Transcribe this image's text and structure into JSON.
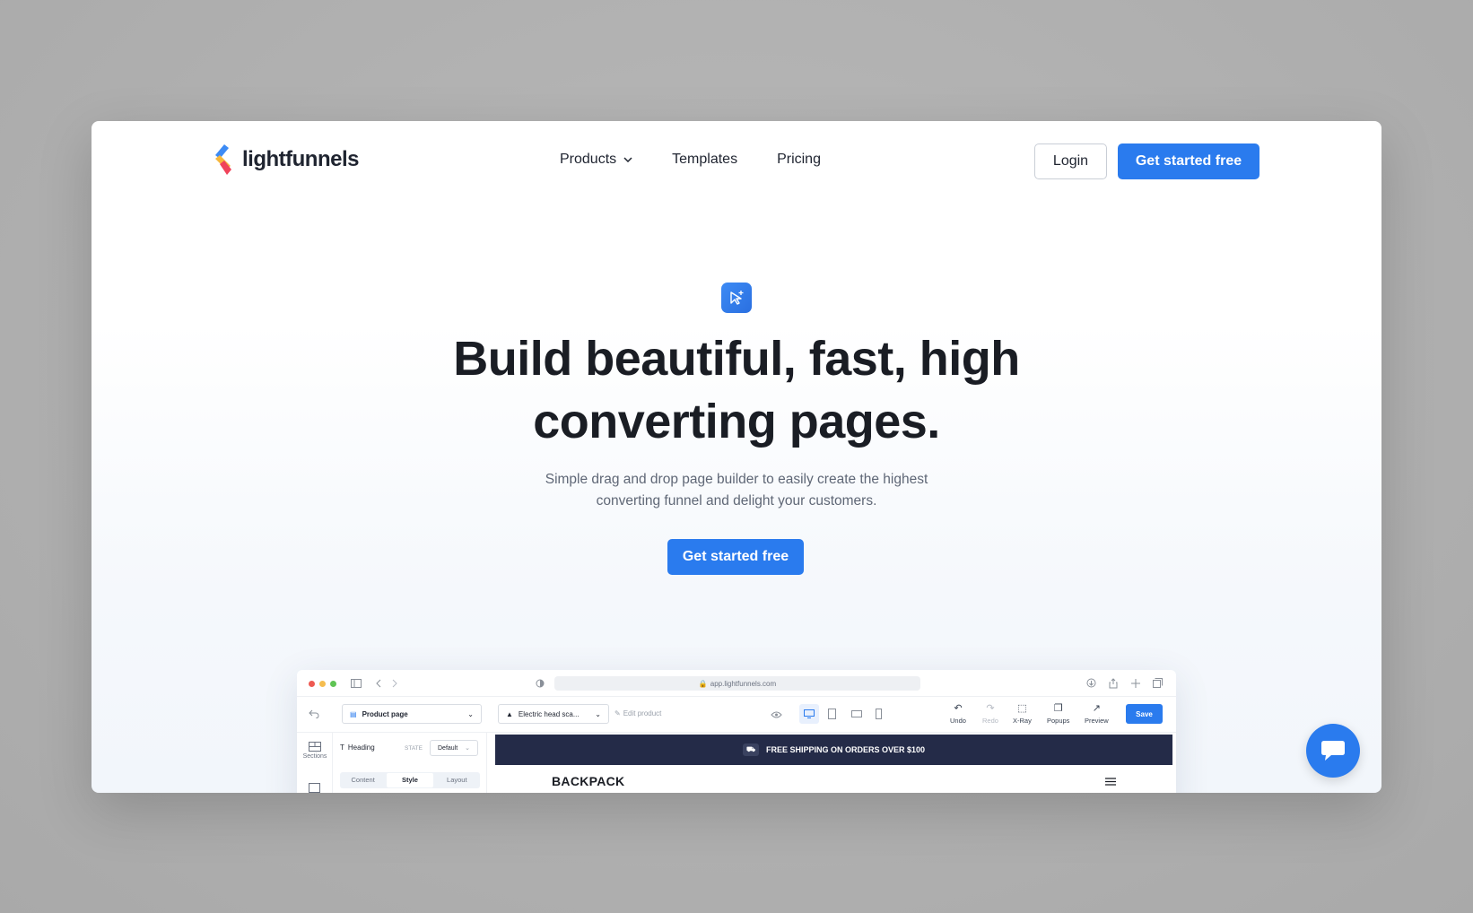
{
  "brand": {
    "name": "lightfunnels"
  },
  "nav": {
    "items": [
      {
        "label": "Products"
      },
      {
        "label": "Templates"
      },
      {
        "label": "Pricing"
      }
    ],
    "login_label": "Login",
    "cta_label": "Get started free"
  },
  "hero": {
    "title_line1": "Build beautiful, fast, high",
    "title_line2": "converting pages.",
    "subtitle_line1": "Simple drag and drop page builder to easily create the highest",
    "subtitle_line2": "converting funnel and delight your customers.",
    "cta_label": "Get started free"
  },
  "mock": {
    "url": "app.lightfunnels.com",
    "page_select": "Product page",
    "product_select": "Electric head sca...",
    "edit_product": "Edit product",
    "toolbar": {
      "undo": "Undo",
      "redo": "Redo",
      "xray": "X-Ray",
      "popups": "Popups",
      "preview": "Preview",
      "save": "Save"
    },
    "sidebar_sections": "Sections",
    "panel": {
      "element": "Heading",
      "state_label": "STATE",
      "state_value": "Default",
      "tabs": [
        "Content",
        "Style",
        "Layout"
      ]
    },
    "banner": "FREE SHIPPING ON ORDERS OVER $100",
    "store_name": "BACKPACK"
  },
  "colors": {
    "accent": "#2a7bee",
    "banner": "#242b48",
    "text": "#1a1d24"
  }
}
